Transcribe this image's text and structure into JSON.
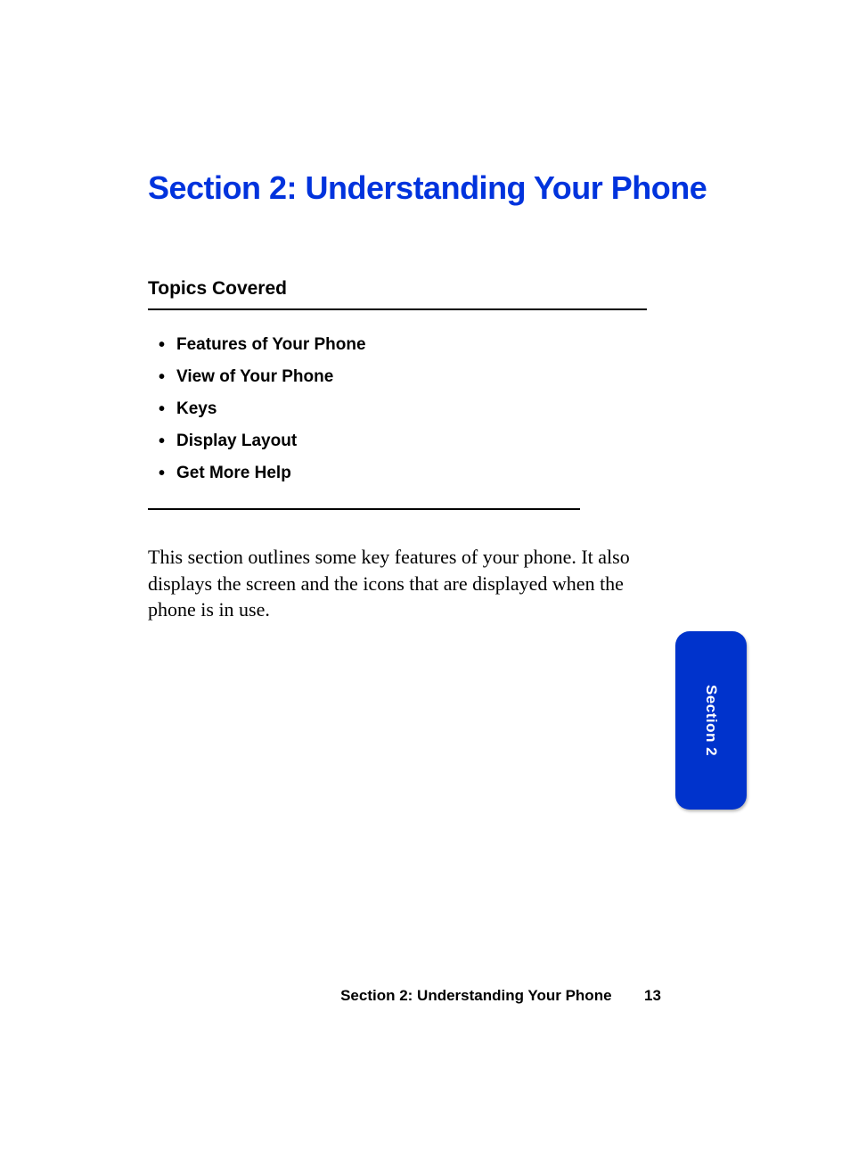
{
  "title": "Section 2: Understanding Your Phone",
  "topics_heading": "Topics Covered",
  "topics": [
    "Features of Your Phone",
    "View of Your Phone",
    "Keys",
    "Display Layout",
    "Get More Help"
  ],
  "body_paragraph": "This section outlines some key features of your phone. It also displays the screen and the icons that are displayed when the phone is in use.",
  "tab_label": "Section 2",
  "footer": {
    "text": "Section 2: Understanding Your Phone",
    "page": "13"
  }
}
